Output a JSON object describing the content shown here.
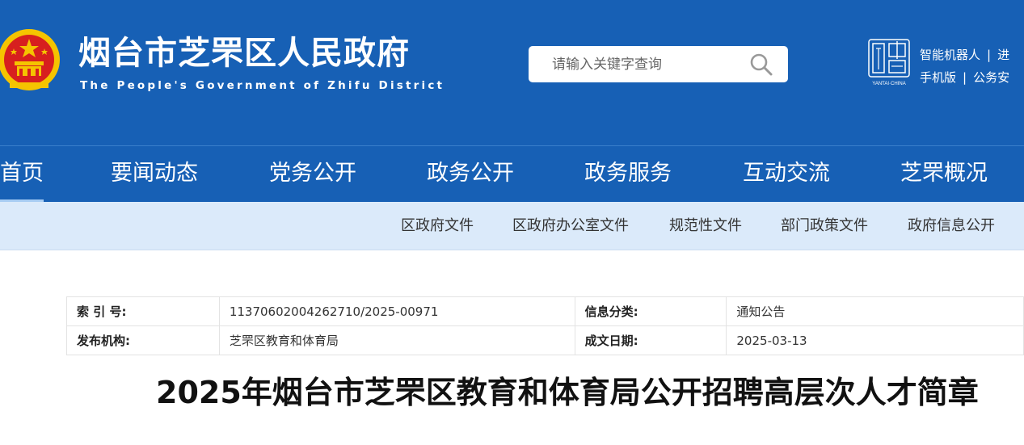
{
  "header": {
    "title": "烟台市芝罘区人民政府",
    "subtitle": "The People's Government of Zhifu District",
    "search": {
      "placeholder": "请输入关键字查询",
      "value": ""
    },
    "top_links_row1": [
      "智能机器人",
      "进"
    ],
    "top_links_row2": [
      "手机版",
      "公务安"
    ],
    "logo_text": "YANTAI·CHINA",
    "colors": {
      "header_bg": "#1760b5",
      "emblem_red": "#d71f1f",
      "emblem_gold": "#f5c400"
    }
  },
  "nav": {
    "items": [
      {
        "label": "首页",
        "active": true
      },
      {
        "label": "要闻动态",
        "active": false
      },
      {
        "label": "党务公开",
        "active": false
      },
      {
        "label": "政务公开",
        "active": false
      },
      {
        "label": "政务服务",
        "active": false
      },
      {
        "label": "互动交流",
        "active": false
      },
      {
        "label": "芝罘概况",
        "active": false
      }
    ]
  },
  "subnav": {
    "items": [
      "区政府文件",
      "区政府办公室文件",
      "规范性文件",
      "部门政策文件",
      "政府信息公开"
    ]
  },
  "meta": {
    "rows": [
      {
        "label1": "索 引 号:",
        "value1": "11370602004262710/2025-00971",
        "label2": "信息分类:",
        "value2": "通知公告"
      },
      {
        "label1": "发布机构:",
        "value1": "芝罘区教育和体育局",
        "label2": "成文日期:",
        "value2": "2025-03-13"
      }
    ]
  },
  "article": {
    "title": "2025年烟台市芝罘区教育和体育局公开招聘高层次人才简章"
  }
}
